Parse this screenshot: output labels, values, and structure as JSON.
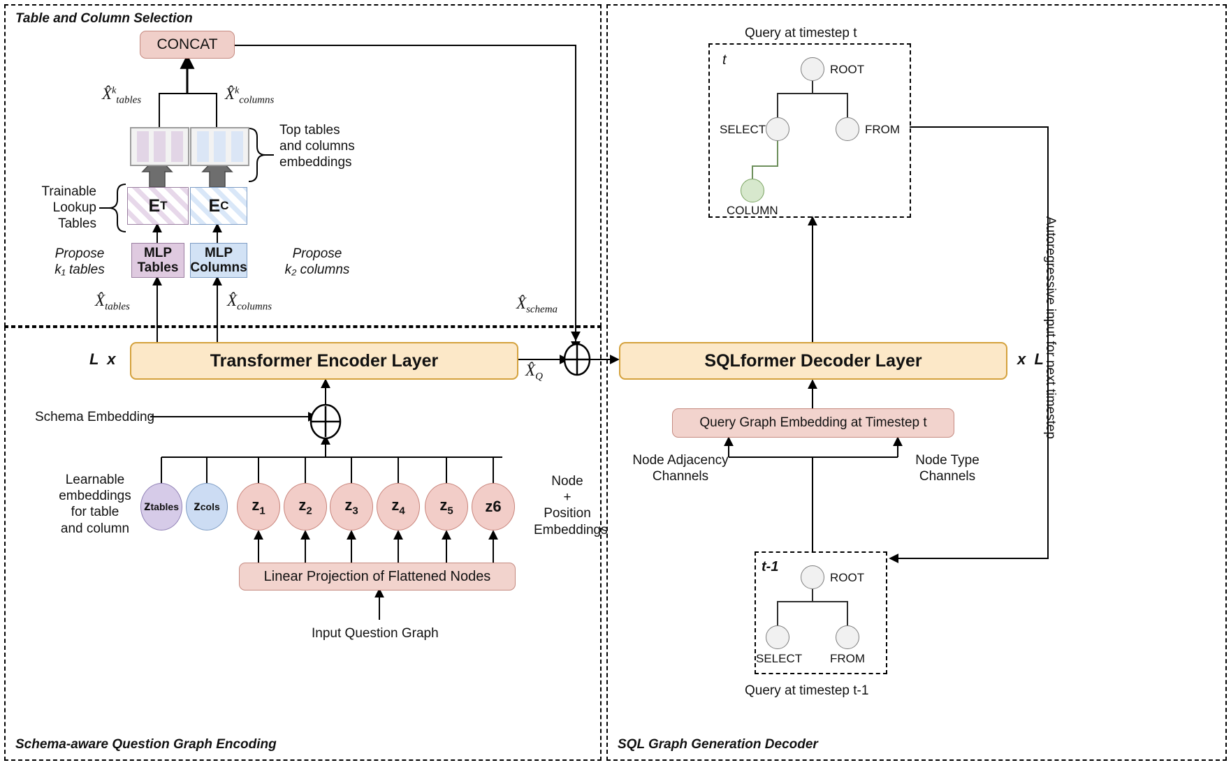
{
  "panels": {
    "table_column_selection": "Table and Column Selection",
    "schema_aware_encoding": "Schema-aware Question Graph Encoding",
    "sql_graph_decoder": "SQL Graph Generation Decoder"
  },
  "encoder_side": {
    "concat": "CONCAT",
    "x_tables_k": {
      "base": "X",
      "sup": "k",
      "sub": "tables"
    },
    "x_columns_k": {
      "base": "X",
      "sup": "k",
      "sub": "columns"
    },
    "top_embeddings_note": "Top tables\nand columns\nembeddings",
    "trainable_lookup": "Trainable\nLookup\nTables",
    "lookup_tables_label": "E",
    "lookup_tables_sub": "T",
    "lookup_columns_label": "E",
    "lookup_columns_sub": "C",
    "mlp_tables": "MLP\nTables",
    "mlp_columns": "MLP\nColumns",
    "propose_k1": "Propose\nk₁ tables",
    "propose_k2": "Propose\nk₂ columns",
    "x_tables": {
      "base": "X",
      "sub": "tables"
    },
    "x_columns": {
      "base": "X",
      "sub": "columns"
    },
    "x_schema": {
      "base": "X",
      "sub": "schema"
    },
    "x_q": {
      "base": "X",
      "sub": "Q"
    },
    "encoder_repeat": "L  x",
    "encoder_title": "Transformer Encoder Layer",
    "schema_embedding": "Schema Embedding",
    "learnable_note": "Learnable\nembeddings\nfor table\nand column",
    "node_position_note": "Node\n+\nPosition\nEmbeddings",
    "linear_projection": "Linear Projection of Flattened Nodes",
    "input_question_graph": "Input Question Graph",
    "nodes": [
      {
        "label": "z",
        "sub": "tables",
        "type": "table"
      },
      {
        "label": "z",
        "sub": "cols",
        "type": "column"
      },
      {
        "label": "z",
        "sub": "1",
        "type": "question"
      },
      {
        "label": "z",
        "sub": "2",
        "type": "question"
      },
      {
        "label": "z",
        "sub": "3",
        "type": "question"
      },
      {
        "label": "z",
        "sub": "4",
        "type": "question"
      },
      {
        "label": "z",
        "sub": "5",
        "type": "question"
      },
      {
        "label": "z",
        "sub": "6",
        "type": "question"
      }
    ]
  },
  "decoder_side": {
    "query_t_caption": "Query at timestep t",
    "query_t_tag": "t",
    "query_t_nodes": [
      "ROOT",
      "SELECT",
      "FROM",
      "COLUMN"
    ],
    "decoder_repeat": "x  L",
    "decoder_title": "SQLformer Decoder Layer",
    "query_graph_embedding": "Query Graph Embedding at Timestep t",
    "node_adjacency_channels": "Node Adjacency\nChannels",
    "node_type_channels": "Node Type\nChannels",
    "query_tminus1_tag": "t-1",
    "query_tminus1_nodes": [
      "ROOT",
      "SELECT",
      "FROM"
    ],
    "query_tminus1_caption": "Query at timestep t-1",
    "autoregressive": "Autoregressive input for next timestep"
  },
  "colors": {
    "encoder_fill": "#fce8c8",
    "encoder_stroke": "#d4a13c",
    "pink_fill": "#f2d3cd",
    "pink_stroke": "#c58a80",
    "table_purple": "#d6cbe8",
    "column_blue": "#ccdcf3",
    "question_pink": "#f2cdc8",
    "column_node_green": "#d7e8cd",
    "graph_node_gray": "#f1f1f1"
  }
}
